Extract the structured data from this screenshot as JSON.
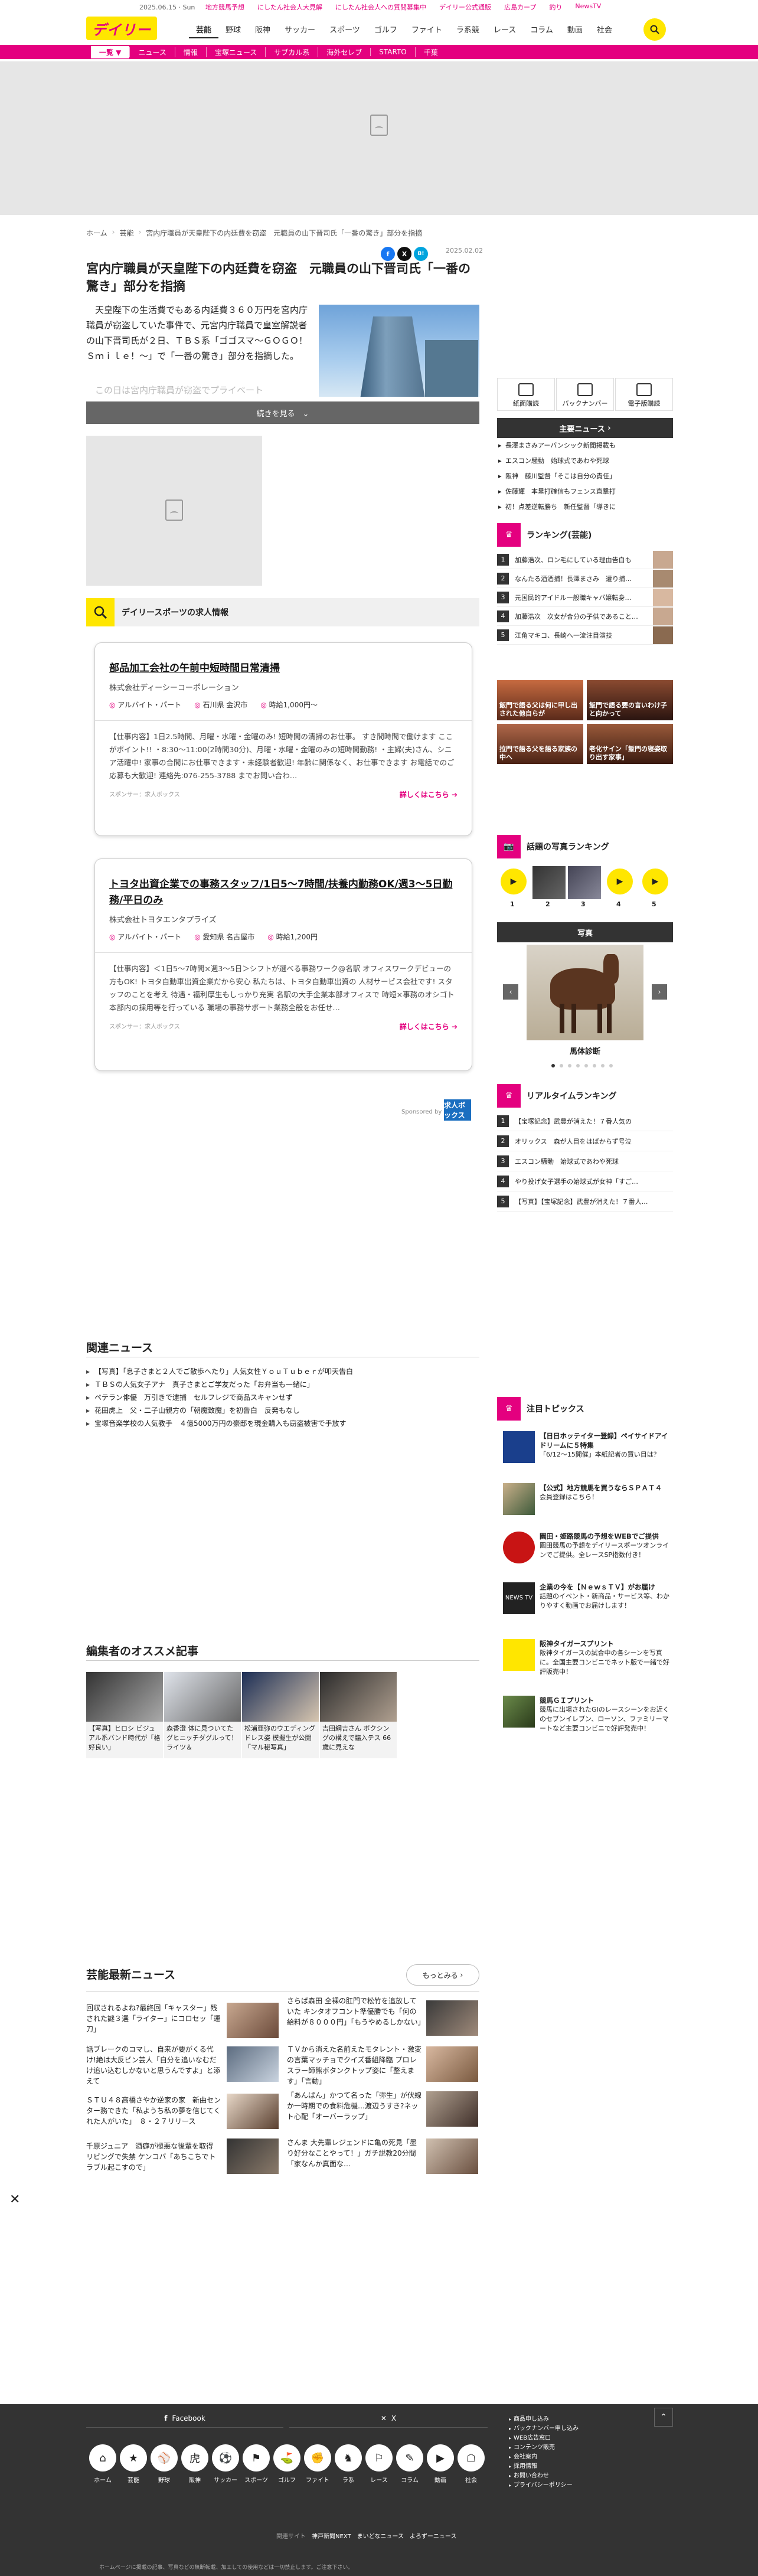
{
  "header": {
    "logo": "デイリー",
    "date": "2025.06.15 · Sun",
    "top_links": [
      "地方競馬予想",
      "にしたん社会人大見解",
      "にしたん社会人への質問募集中",
      "デイリー公式通販",
      "広島カープ",
      "釣り",
      "NewsTV"
    ],
    "main_nav": [
      "芸能",
      "野球",
      "阪神",
      "サッカー",
      "スポーツ",
      "ゴルフ",
      "ファイト",
      "ラ系競",
      "レース",
      "コラム",
      "動画",
      "社会"
    ],
    "sub_nav": [
      "一覧 ▼",
      "ニュース",
      "情報",
      "宝塚ニュース",
      "サブカル系",
      "海外セレブ",
      "STARTO",
      "千葉"
    ]
  },
  "breadcrumb": [
    "ホーム",
    "芸能",
    "宮内庁職員が天皇陛下の内廷費を窃盗　元職員の山下晋司氏「一番の驚き」部分を指摘"
  ],
  "article": {
    "title": "宮内庁職員が天皇陛下の内廷費を窃盗　元職員の山下晋司氏「一番の驚き」部分を指摘",
    "date": "2025.02.02",
    "share": [
      "f",
      "X",
      "B!"
    ],
    "lead": "　天皇陛下の生活費でもある内廷費３６０万円を宮内庁職員が窃盗していた事件で、元宮内庁職員で皇室解説者の山下晋司氏が２日、ＴＢＳ系「ゴゴスマ～ＧＯＧＯ！Ｓｍｉｌｅ！～」で「一番の驚き」部分を指摘した。",
    "lead_fade": "　この日は宮内庁職員が窃盗でプライベート",
    "more_button": "続きを見る　⌄"
  },
  "jobs": {
    "heading": "デイリースポーツの求人情報",
    "cards": [
      {
        "title": "部品加工会社の午前中短時間日常清掃",
        "company": "株式会社ディーシーコーポレーション",
        "type": "アルバイト・パート",
        "place": "石川県 金沢市",
        "wage": "時給1,000円〜",
        "desc": "【仕事内容】1日2.5時間、月曜・水曜・金曜のみ! 短時間の清掃のお仕事。 すき間時間で働けます ここがポイント!! ・8:30〜11:00(2時間30分)、月曜・水曜・金曜のみの短時間勤務! ・主婦(夫)さん、シニア活躍中! 家事の合間にお仕事できます・未経験者歓迎! 年齢に関係なく、お仕事できます お電話でのご応募も大歓迎! 連絡先:076-255-3788 までお問い合わ…",
        "sponsor": "スポンサー：求人ボックス",
        "more": "詳しくはこちら"
      },
      {
        "title": "トヨタ出資企業での事務スタッフ/1日5～7時間/扶養内勤務OK/週3～5日勤務/平日のみ",
        "company": "株式会社トヨタエンタプライズ",
        "type": "アルバイト・パート",
        "place": "愛知県 名古屋市",
        "wage": "時給1,200円",
        "desc": "【仕事内容】＜1日5〜7時間×週3〜5日＞シフトが選べる事務ワーク@名駅 オフィスワークデビューの方もOK! トヨタ自動車出資企業だから安心 私たちは、トヨタ自動車出資の 人材サービス会社です! スタッフのことを考え 待遇・福利厚生もしっかり充実 名駅の大手企業本部オフィスで 時短×事務のオシゴト 本部内の採用等を行っている 職場の事務サポート業務全般をお任せ…",
        "sponsor": "スポンサー：求人ボックス",
        "more": "詳しくはこちら"
      }
    ],
    "sponsored_by": "Sponsored by",
    "sponsor_logo": "求人ボックス"
  },
  "related": {
    "heading": "関連ニュース",
    "items": [
      "【写真】「息子さまと２人でご散歩へたり」人気女性ＹｏｕＴｕｂｅｒが叩天告白",
      "ＴＢＳの人気女子アナ　真子さまとご学友だった「お弁当も一緒に」",
      "ペテラン俳優　万引きで逮捕　セルフレジで商品スキャンせず",
      "花田虎上　父・二子山親方の「朝魔致魔」を初告白　反発もなし",
      "宝塚音楽学校の人気教手　４億5000万円の豪邸を現金購入も窃盗被害で手放す"
    ]
  },
  "picks": {
    "heading": "編集者のオススメ記事",
    "items": [
      "【写真】ヒロシ ビジュアル系バンド時代が「格好良い」",
      "森香澄 体に見ついてたグヒニッチダグルって！ライツ＆",
      "松浦亜弥のウエディングドレス姿 模擬生が公開「マル秘写真」",
      "吉田綱吉さん ボクシングの構えで臨入テス 66歳に見えな"
    ]
  },
  "geino": {
    "heading": "芸能最新ニュース",
    "more": "もっとみる",
    "items": [
      "回収されるよね?最終回「キャスター」残された謎３選「ライター」にコロセッ「運刀」",
      "さらば森田 全裸の肛門で松竹を追放していた キンタオフコント準優勝でも「何の給料が８０００円」「もうやめるしかない」",
      "話ブレークのコマし、自来が要がくる代け!絶は大反ビン芸人「自分を追いなむだけ追い込むしかないと思うんですよ」と添えて",
      "ＴＶから消えた名前えたモタレント・激変の言葉マッチョでクイズ番組降臨 プロレスラー師熊ボタンクトップ姿に「整えます」「言動」",
      "ＳＴＵ４８高橋さやか逆家の家　新曲センター務できた「私ようち私の夢を信じてくれた人がいた」　８・２７リリース",
      "「あんぱん」かつて名った「弥生」が伏線か一時期での食料危機…渡辺うすき?ネット心配「オーバーラップ」",
      "千原ジュニア　酒癖が極悪な後輩を取得　リビングで失禁 ケンコバ「あちこちでトラブル起こすので」",
      "さんま 大先輩レジェンドに亀の死見「墨り好分なことやって！」ガチ説教20分間「家なんか真面な…"
    ]
  },
  "sidebar": {
    "tri_buttons": [
      "紙面購読",
      "バックナンバー",
      "電子版購読"
    ],
    "main_news": {
      "heading": "主要ニュース",
      "items": [
        "長澤まさみアーバンシック新聞掲載も",
        "エスコン騒動　始球式であわや死球",
        "阪神　藤川監督「そこは自分の責任」",
        "佐藤輝　本塁打確信もフェンス直撃打",
        "初！点差逆転勝ち　新任監督「導きに"
      ]
    },
    "ranking": {
      "heading": "ランキング(芸能)",
      "items": [
        "加藤浩次、ロン毛にしている理由告白も",
        "なんたる酒酒捕！長澤まさみ　遭り捕…",
        "元国民的アイドル一般職キャバ嬢転身…",
        "加藤浩次　次女が合分の子供であること…",
        "江角マキコ、長崎へ一流注目演技"
      ]
    },
    "tiles": [
      "飯門で語る父は何に甲し出された他自らが",
      "飯門で語る要の言いわけ子と向かって",
      "拉門で語る父を語る家族の中へ",
      "老化サイン「飯門の寝姿取り出す家事」"
    ],
    "photo_ranking": {
      "heading": "話題の写真ランキング",
      "nums": [
        "1",
        "2",
        "3",
        "4",
        "5"
      ]
    },
    "photo": {
      "heading": "写真",
      "caption": "馬体診断"
    },
    "realtime": {
      "heading": "リアルタイムランキング",
      "items": [
        "【宝塚記念】武豊が消えた！７番人気の",
        "オリックス　森が人目をはばからず号泣",
        "エスコン騒動　始球式であわや死球",
        "やり投げ女子選手の始球式が女神「すご…",
        "【写真】【宝塚記念】武豊が消えた！７番人…"
      ]
    },
    "topics": {
      "heading": "注目トピックス",
      "items": [
        {
          "t": "【日日ホッテイター登録】ペイサイドアイドリームに５特集",
          "d": "「6/12〜15開催」本紙記者の買い目は？"
        },
        {
          "t": "【公式】地方競馬を買うならＳＰＡＴ４",
          "d": "会員登録はこちら！"
        },
        {
          "t": "園田・姫路競馬の予想をWEBでご提供",
          "d": "園田競馬の予想をデイリースポーツオンラインでご提供。全レースSP指数付き！"
        },
        {
          "t": "企業の今を【ＮｅｗｓＴＶ】がお届け",
          "d": "話題のイベント・新商品・サービス等、わかりやすく動画でお届けします！"
        },
        {
          "t": "阪神タイガースプリント",
          "d": "阪神タイガースの試合中の各シーンを写真に。全国主要コンビニでネット版で一緒で好評販売中！"
        },
        {
          "t": "競馬ＧＩプリント",
          "d": "競馬に出場されたGIのレースシーンをお近くのセブンイレブン、ローソン、ファミリーマートなど主要コンビニで好評発売中！"
        }
      ]
    }
  },
  "footer": {
    "facebook": "Facebook",
    "x": "X",
    "icons": [
      "ホーム",
      "芸能",
      "野球",
      "阪神",
      "サッカー",
      "スポーツ",
      "ゴルフ",
      "ファイト",
      "ラ系",
      "レース",
      "コラム",
      "動画",
      "社会"
    ],
    "links": [
      "商品申し込み",
      "バックナンバー申し込み",
      "WEB広告窓口",
      "コンテンツ販売",
      "会社案内",
      "採用情報",
      "お問い合わせ",
      "プライバシーポリシー"
    ],
    "bottom": [
      "関連サイト",
      "神戸新聞NEXT",
      "まいどなニュース",
      "よろずーニュース"
    ],
    "copyright": "ホームページに掲載の記事、写真などの無断転載、加工しての使用などは一切禁止します。ご注意下さい。"
  },
  "colors": {
    "brand_pink": "#e4007f",
    "brand_yellow": "#ffe600",
    "footer": "#333333"
  }
}
